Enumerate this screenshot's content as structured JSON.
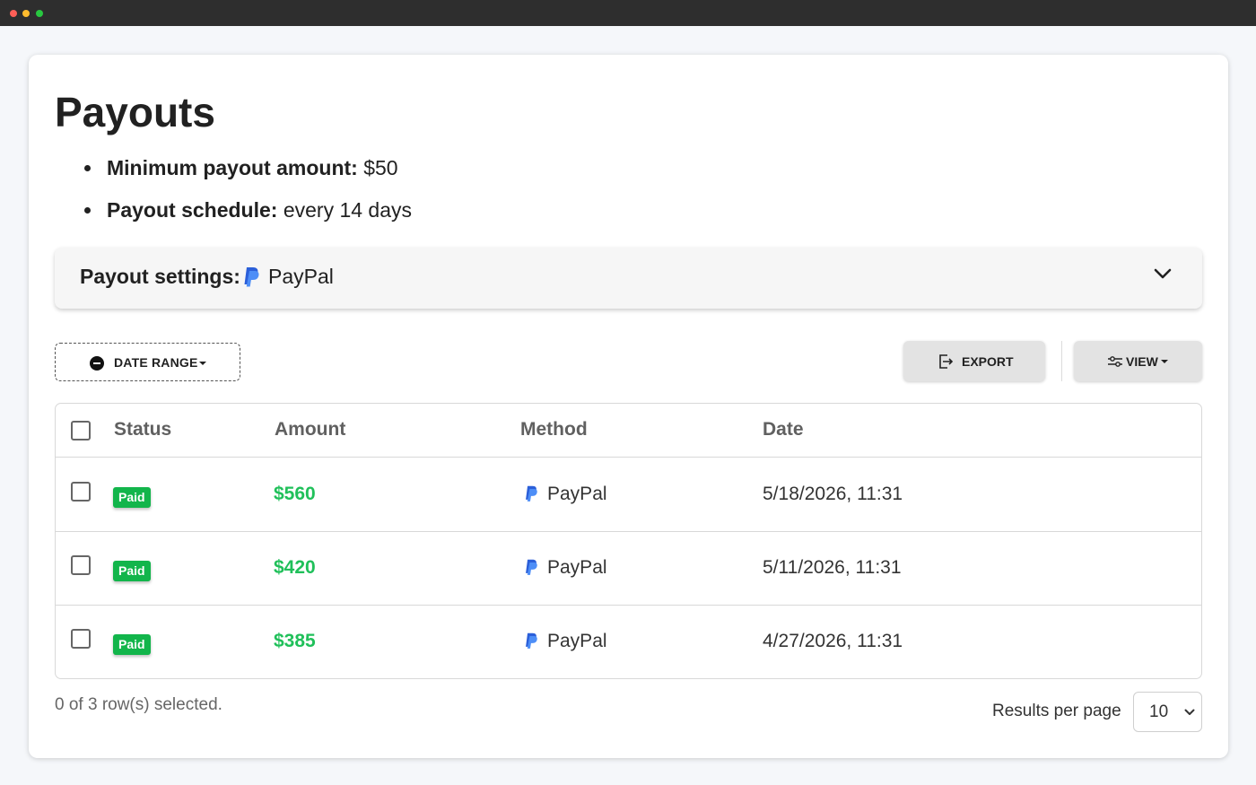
{
  "window": {
    "title_dots": [
      "close",
      "minimize",
      "maximize"
    ]
  },
  "page": {
    "title": "Payouts"
  },
  "info": [
    {
      "label": "Minimum payout amount:",
      "value": " $50"
    },
    {
      "label": "Payout schedule:",
      "value": " every 14 days"
    }
  ],
  "settings": {
    "label": "Payout settings:",
    "value": "PayPal",
    "icon": "paypal-icon",
    "expand_icon": "chevron-down-icon"
  },
  "toolbar": {
    "date_range_label": "DATE RANGE",
    "export_label": "EXPORT",
    "view_label": "VIEW"
  },
  "table": {
    "columns": [
      "Status",
      "Amount",
      "Method",
      "Date"
    ],
    "rows": [
      {
        "status": "Paid",
        "amount": "$560",
        "method": "PayPal",
        "date": "5/18/2026, 11:31"
      },
      {
        "status": "Paid",
        "amount": "$420",
        "method": "PayPal",
        "date": "5/11/2026, 11:31"
      },
      {
        "status": "Paid",
        "amount": "$385",
        "method": "PayPal",
        "date": "4/27/2026, 11:31"
      }
    ]
  },
  "footer": {
    "selection_text": "0 of 3 row(s) selected.",
    "rpp_label": "Results per page",
    "rpp_value": "10"
  },
  "colors": {
    "paid_badge": "#12b54b",
    "amount": "#20c05a",
    "paypal_blue": "#3b7bf6"
  }
}
